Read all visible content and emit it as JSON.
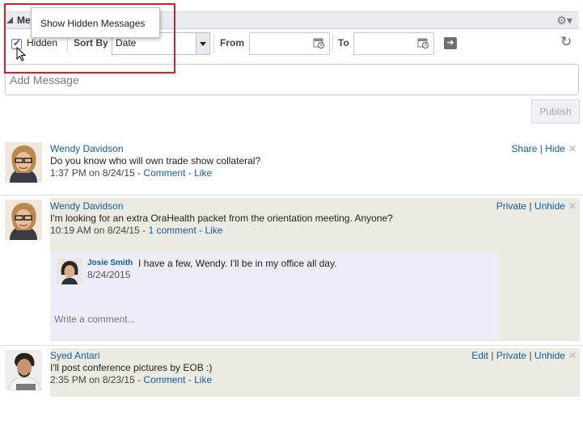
{
  "panel": {
    "title": "Me"
  },
  "tooltip": {
    "text": "Show Hidden Messages"
  },
  "toolbar": {
    "hidden_label": "Hidden",
    "sortby_label": "Sort By",
    "sort_value": "Date",
    "from_label": "From",
    "to_label": "To",
    "from_value": "",
    "to_value": ""
  },
  "composer": {
    "placeholder": "Add Message",
    "publish_label": "Publish"
  },
  "messages": [
    {
      "author": "Wendy Davidson",
      "text": "Do you know who will own trade show collateral?",
      "time": "1:37 PM on 8/24/15",
      "dash": " - ",
      "comment_link": "Comment",
      "like_link": "Like",
      "actions": [
        "Share",
        "Hide"
      ]
    },
    {
      "author": "Wendy Davidson",
      "text": "I'm looking for an extra OraHealth packet from the orientation meeting. Anyone?",
      "time": "10:19 AM on 8/24/15",
      "dash": " - ",
      "comment_link": "1 comment",
      "like_link": "Like",
      "actions": [
        "Private",
        "Unhide"
      ],
      "comment": {
        "author": "Josie Smith",
        "text": "I have a few, Wendy. I'll be in my office all day.",
        "date": "8/24/2015",
        "write_placeholder": "Write a comment..."
      }
    },
    {
      "author": "Syed Antari",
      "text": "I'll post conference pictures by EOB :)",
      "time": "2:35 PM on 8/23/15",
      "dash": " - ",
      "comment_link": "Comment",
      "like_link": "Like",
      "actions": [
        "Edit",
        "Private",
        "Unhide"
      ]
    }
  ],
  "separator": " | ",
  "colors": {
    "link": "#145c9e",
    "hidden_bg": "#ecebe3",
    "comment_bg": "#ecedf8",
    "highlight": "#d6202b"
  }
}
